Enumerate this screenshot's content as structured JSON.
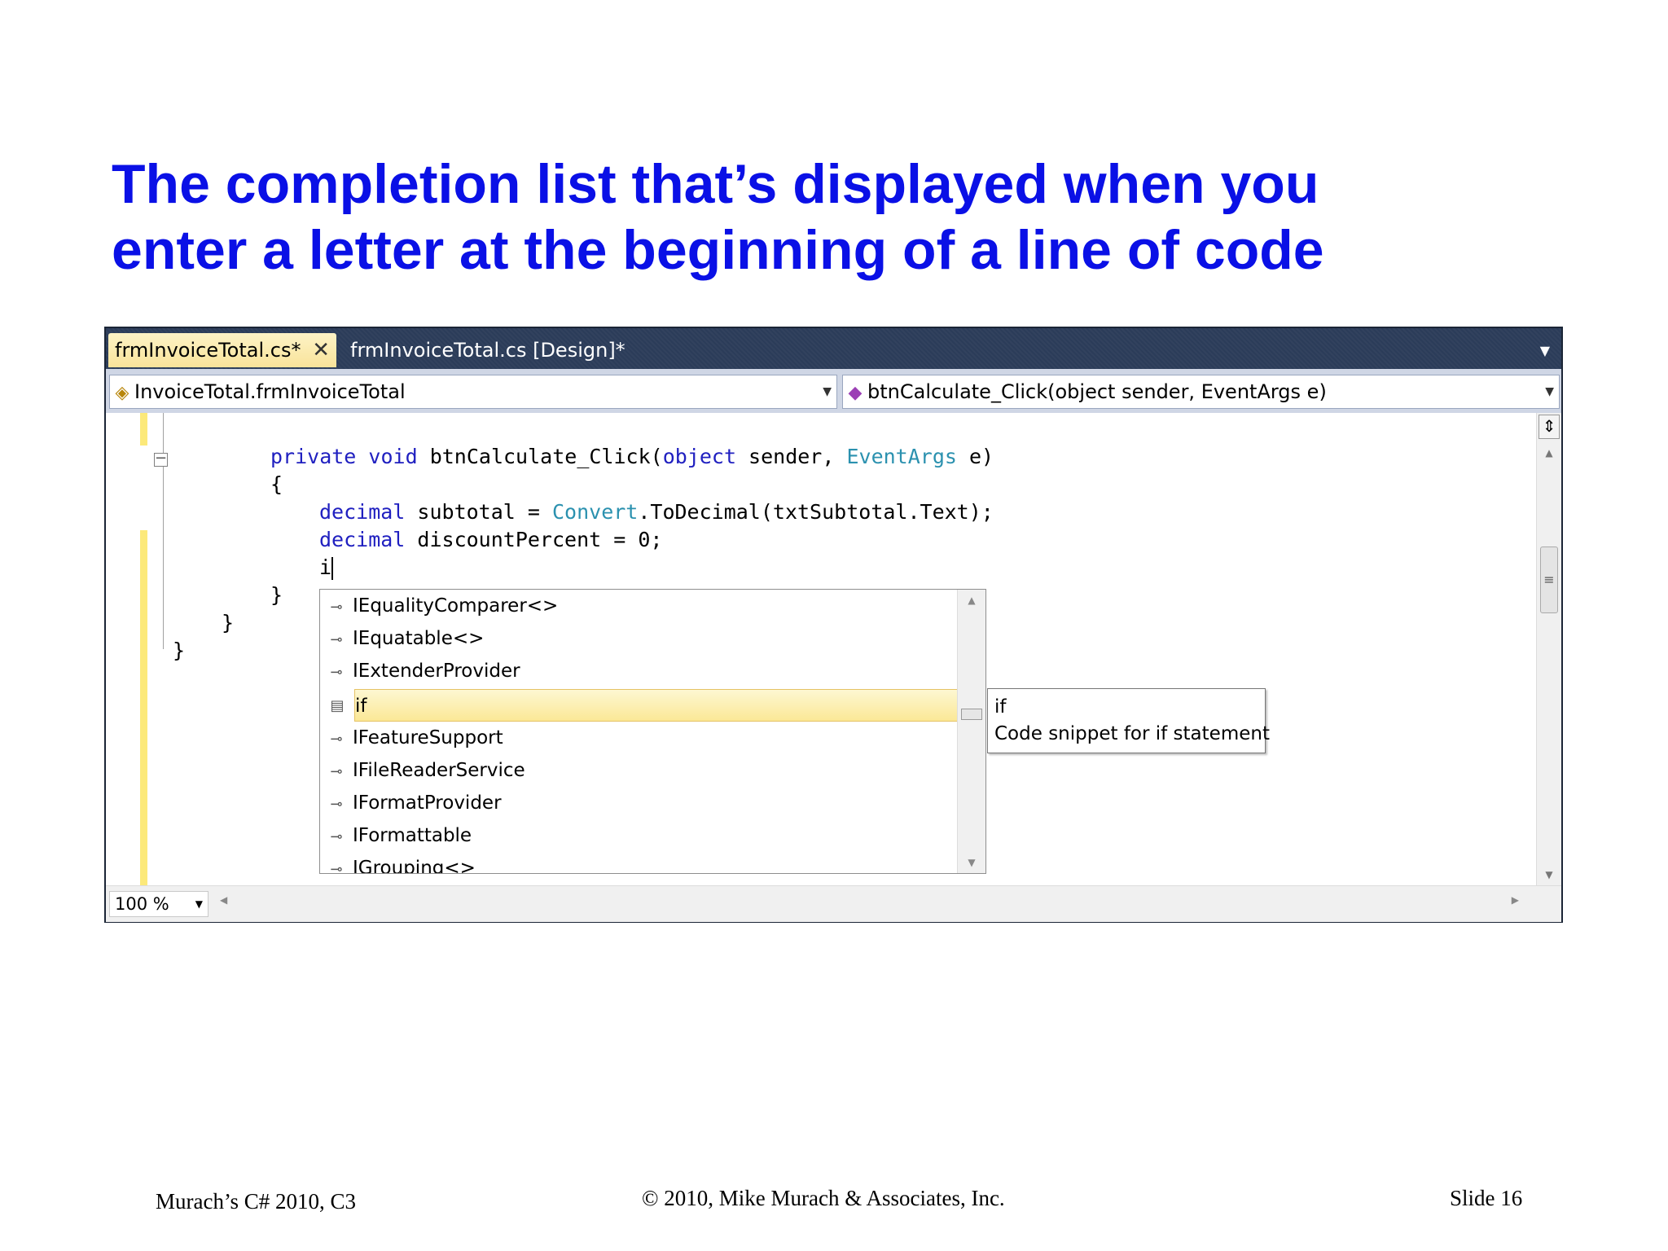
{
  "slide": {
    "title_lines": [
      "The completion list that’s displayed when you",
      "enter a letter at the beginning of a line of code"
    ]
  },
  "ide": {
    "tabs": [
      {
        "label": "frmInvoiceTotal.cs*",
        "active": true
      },
      {
        "label": "frmInvoiceTotal.cs [Design]*",
        "active": false
      }
    ],
    "class_combo": "InvoiceTotal.frmInvoiceTotal",
    "member_combo": "btnCalculate_Click(object sender, EventArgs e)",
    "code": {
      "line1_kw1": "private",
      "line1_kw2": "void",
      "line1_name": "btnCalculate_Click(",
      "line1_kw3": "object",
      "line1_mid": " sender, ",
      "line1_type": "EventArgs",
      "line1_end": " e)",
      "line2": "{",
      "line3_kw": "decimal",
      "line3_mid": " subtotal = ",
      "line3_type": "Convert",
      "line3_end": ".ToDecimal(txtSubtotal.Text);",
      "line4_kw": "decimal",
      "line4_end": " discountPercent = 0;",
      "line5": "i",
      "line6": "}",
      "line7": "}",
      "line8": "}"
    },
    "completion_list": {
      "items": [
        {
          "label": "IEqualityComparer<>",
          "icon": "interface-icon"
        },
        {
          "label": "IEquatable<>",
          "icon": "interface-icon"
        },
        {
          "label": "IExtenderProvider",
          "icon": "interface-icon"
        },
        {
          "label": "if",
          "icon": "snippet-icon",
          "selected": true
        },
        {
          "label": "IFeatureSupport",
          "icon": "interface-icon"
        },
        {
          "label": "IFileReaderService",
          "icon": "interface-icon"
        },
        {
          "label": "IFormatProvider",
          "icon": "interface-icon"
        },
        {
          "label": "IFormattable",
          "icon": "interface-icon"
        },
        {
          "label": "IGrouping<>",
          "icon": "interface-icon"
        }
      ]
    },
    "tooltip": {
      "title": "if",
      "description": "Code snippet for if statement"
    },
    "zoom": "100 %"
  },
  "footer": {
    "left": "Murach’s C# 2010, C3",
    "center": "© 2010, Mike Murach & Associates, Inc.",
    "right": "Slide 16"
  }
}
